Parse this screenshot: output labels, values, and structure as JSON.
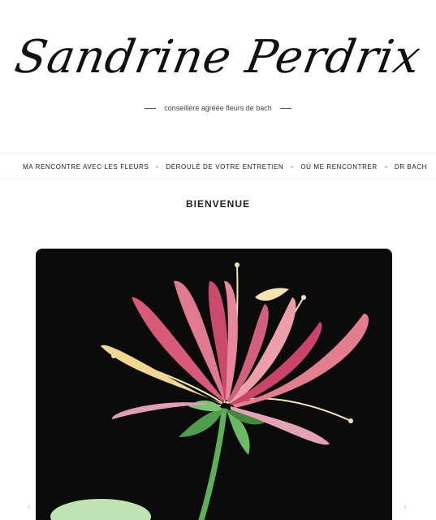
{
  "header": {
    "site_title": "Sandrine Perdrix",
    "tagline": "conseillère agréée fleurs de bach"
  },
  "nav": {
    "items": [
      "MA RENCONTRE AVEC LES FLEURS",
      "DÉROULÉ DE VOTRE ENTRETIEN",
      "OÙ ME RENCONTRER",
      "DR BACH"
    ]
  },
  "main": {
    "heading": "BIENVENUE"
  },
  "slider": {
    "prev_icon": "chevron-left-icon",
    "next_icon": "chevron-right-icon"
  },
  "colors": {
    "background": "#ffffff",
    "text": "#222222",
    "hero_background": "#0b0b0b",
    "petal_pink": "#d85a78",
    "petal_cream": "#f3e3b0",
    "leaf_green": "#5fae5a"
  }
}
